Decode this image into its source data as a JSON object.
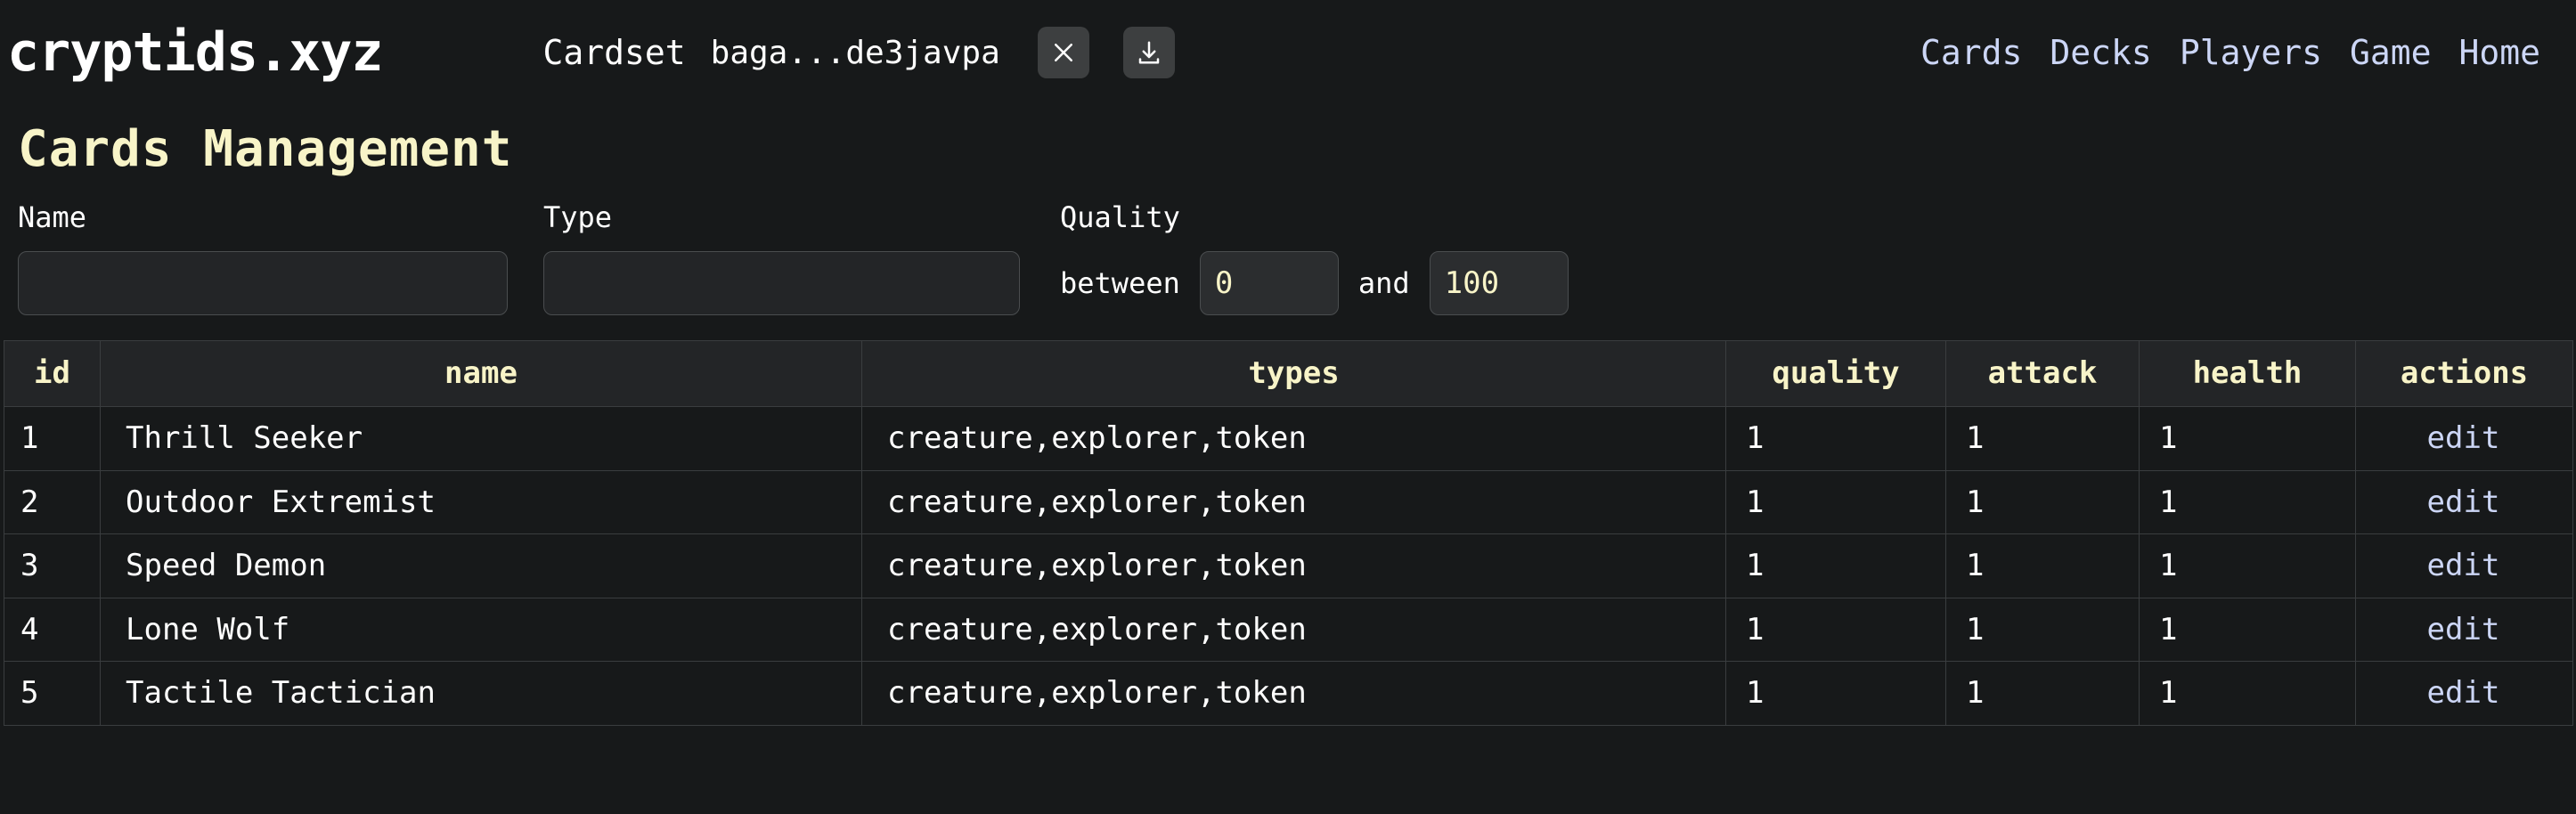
{
  "header": {
    "brand": "cryptids.xyz",
    "cardset_label": "Cardset",
    "cardset_id": "baga...de3javpa",
    "close_icon": "close-icon",
    "download_icon": "download-icon",
    "nav": [
      {
        "label": "Cards"
      },
      {
        "label": "Decks"
      },
      {
        "label": "Players"
      },
      {
        "label": "Game"
      },
      {
        "label": "Home"
      }
    ]
  },
  "page": {
    "title": "Cards Management"
  },
  "filters": {
    "name": {
      "label": "Name",
      "value": "",
      "placeholder": ""
    },
    "type": {
      "label": "Type",
      "value": "",
      "placeholder": ""
    },
    "quality": {
      "label": "Quality",
      "between_word": "between",
      "and_word": "and",
      "min": "0",
      "max": "100"
    }
  },
  "table": {
    "columns": [
      {
        "key": "id",
        "label": "id"
      },
      {
        "key": "name",
        "label": "name"
      },
      {
        "key": "types",
        "label": "types"
      },
      {
        "key": "quality",
        "label": "quality"
      },
      {
        "key": "attack",
        "label": "attack"
      },
      {
        "key": "health",
        "label": "health"
      },
      {
        "key": "actions",
        "label": "actions"
      }
    ],
    "edit_label": "edit",
    "rows": [
      {
        "id": "1",
        "name": "Thrill Seeker",
        "types": "creature,explorer,token",
        "quality": "1",
        "attack": "1",
        "health": "1",
        "action": "edit"
      },
      {
        "id": "2",
        "name": "Outdoor Extremist",
        "types": "creature,explorer,token",
        "quality": "1",
        "attack": "1",
        "health": "1",
        "action": "edit"
      },
      {
        "id": "3",
        "name": "Speed Demon",
        "types": "creature,explorer,token",
        "quality": "1",
        "attack": "1",
        "health": "1",
        "action": "edit"
      },
      {
        "id": "4",
        "name": "Lone Wolf",
        "types": "creature,explorer,token",
        "quality": "1",
        "attack": "1",
        "health": "1",
        "action": "edit"
      },
      {
        "id": "5",
        "name": "Tactile Tactician",
        "types": "creature,explorer,token",
        "quality": "1",
        "attack": "1",
        "health": "1",
        "action": "edit"
      }
    ]
  },
  "colors": {
    "background": "#17191a",
    "accent_cream": "#f8f4c8",
    "link_blue": "#ccd6f6",
    "header_row": "#232527",
    "border": "#3a3d3f",
    "button_grey": "#3d3f40"
  }
}
